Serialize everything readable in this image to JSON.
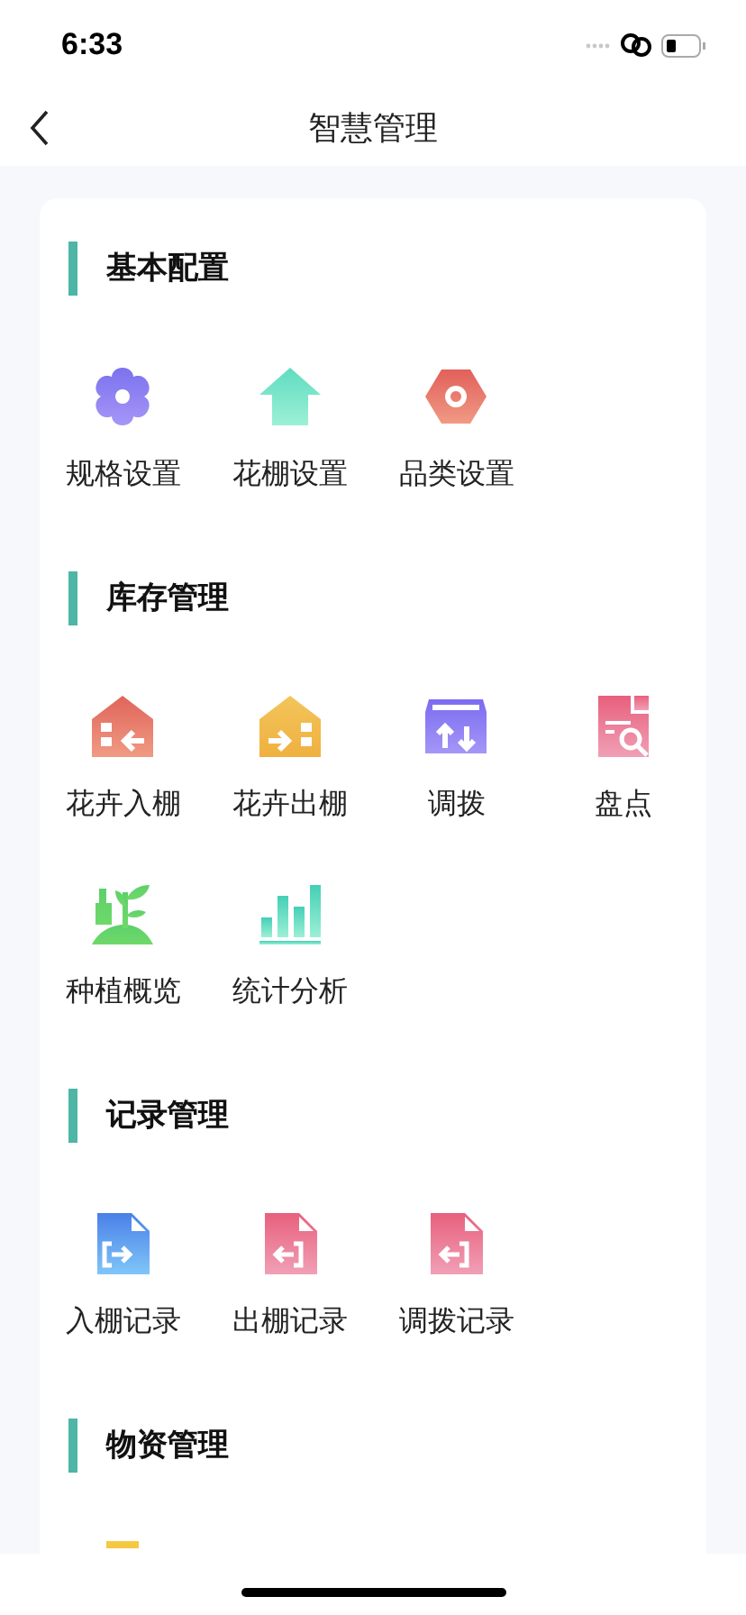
{
  "status_bar": {
    "time": "6:33"
  },
  "nav": {
    "title": "智慧管理"
  },
  "sections": [
    {
      "title": "基本配置",
      "items": [
        {
          "label": "规格设置",
          "kind": "flower"
        },
        {
          "label": "花棚设置",
          "kind": "house"
        },
        {
          "label": "品类设置",
          "kind": "hexagon"
        }
      ]
    },
    {
      "title": "库存管理",
      "items": [
        {
          "label": "花卉入棚",
          "kind": "house-in"
        },
        {
          "label": "花卉出棚",
          "kind": "house-out"
        },
        {
          "label": "调拨",
          "kind": "box"
        },
        {
          "label": "盘点",
          "kind": "doc-search"
        },
        {
          "label": "种植概览",
          "kind": "plant"
        },
        {
          "label": "统计分析",
          "kind": "bars"
        }
      ]
    },
    {
      "title": "记录管理",
      "items": [
        {
          "label": "入棚记录",
          "kind": "file-in"
        },
        {
          "label": "出棚记录",
          "kind": "file-out"
        },
        {
          "label": "调拨记录",
          "kind": "file-out"
        }
      ]
    },
    {
      "title": "物资管理",
      "items": [
        {
          "kind": "partial"
        }
      ]
    }
  ]
}
